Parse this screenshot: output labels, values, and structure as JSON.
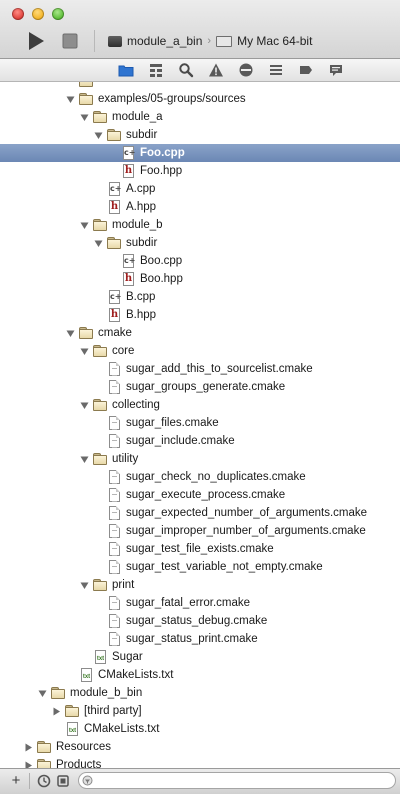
{
  "toolbar": {
    "scheme_target": "module_a_bin",
    "scheme_chevron": "›",
    "destination": "My Mac 64-bit",
    "icons": [
      "run-icon",
      "stop-icon",
      "scheme-icon",
      "mac-device-icon"
    ]
  },
  "navigator_tabs": [
    {
      "name": "project-navigator",
      "icon": "folder-icon",
      "active": true
    },
    {
      "name": "symbol-navigator",
      "icon": "hierarchy-icon",
      "active": false
    },
    {
      "name": "search-navigator",
      "icon": "search-icon",
      "active": false
    },
    {
      "name": "issue-navigator",
      "icon": "warning-icon",
      "active": false
    },
    {
      "name": "test-navigator",
      "icon": "diamond-icon",
      "active": false
    },
    {
      "name": "debug-navigator",
      "icon": "list-icon",
      "active": false
    },
    {
      "name": "breakpoint-navigator",
      "icon": "breakpoint-icon",
      "active": false
    },
    {
      "name": "log-navigator",
      "icon": "speech-bubble-icon",
      "active": false
    }
  ],
  "tree": [
    {
      "label": "",
      "type": "folder",
      "depth": 3,
      "disclosure": "none",
      "partial": true
    },
    {
      "label": "examples/05-groups/sources",
      "type": "folder",
      "depth": 3,
      "disclosure": "open"
    },
    {
      "label": "module_a",
      "type": "folder",
      "depth": 4,
      "disclosure": "open"
    },
    {
      "label": "subdir",
      "type": "folder",
      "depth": 5,
      "disclosure": "open"
    },
    {
      "label": "Foo.cpp",
      "type": "cpp",
      "depth": 6,
      "disclosure": "none",
      "selected": true
    },
    {
      "label": "Foo.hpp",
      "type": "hpp",
      "depth": 6,
      "disclosure": "none"
    },
    {
      "label": "A.cpp",
      "type": "cpp",
      "depth": 5,
      "disclosure": "none"
    },
    {
      "label": "A.hpp",
      "type": "hpp",
      "depth": 5,
      "disclosure": "none"
    },
    {
      "label": "module_b",
      "type": "folder",
      "depth": 4,
      "disclosure": "open"
    },
    {
      "label": "subdir",
      "type": "folder",
      "depth": 5,
      "disclosure": "open"
    },
    {
      "label": "Boo.cpp",
      "type": "cpp",
      "depth": 6,
      "disclosure": "none"
    },
    {
      "label": "Boo.hpp",
      "type": "hpp",
      "depth": 6,
      "disclosure": "none"
    },
    {
      "label": "B.cpp",
      "type": "cpp",
      "depth": 5,
      "disclosure": "none"
    },
    {
      "label": "B.hpp",
      "type": "hpp",
      "depth": 5,
      "disclosure": "none"
    },
    {
      "label": "cmake",
      "type": "folder",
      "depth": 3,
      "disclosure": "open"
    },
    {
      "label": "core",
      "type": "folder",
      "depth": 4,
      "disclosure": "open"
    },
    {
      "label": "sugar_add_this_to_sourcelist.cmake",
      "type": "doc",
      "depth": 5,
      "disclosure": "none"
    },
    {
      "label": "sugar_groups_generate.cmake",
      "type": "doc",
      "depth": 5,
      "disclosure": "none"
    },
    {
      "label": "collecting",
      "type": "folder",
      "depth": 4,
      "disclosure": "open"
    },
    {
      "label": "sugar_files.cmake",
      "type": "doc",
      "depth": 5,
      "disclosure": "none"
    },
    {
      "label": "sugar_include.cmake",
      "type": "doc",
      "depth": 5,
      "disclosure": "none"
    },
    {
      "label": "utility",
      "type": "folder",
      "depth": 4,
      "disclosure": "open"
    },
    {
      "label": "sugar_check_no_duplicates.cmake",
      "type": "doc",
      "depth": 5,
      "disclosure": "none"
    },
    {
      "label": "sugar_execute_process.cmake",
      "type": "doc",
      "depth": 5,
      "disclosure": "none"
    },
    {
      "label": "sugar_expected_number_of_arguments.cmake",
      "type": "doc",
      "depth": 5,
      "disclosure": "none"
    },
    {
      "label": "sugar_improper_number_of_arguments.cmake",
      "type": "doc",
      "depth": 5,
      "disclosure": "none"
    },
    {
      "label": "sugar_test_file_exists.cmake",
      "type": "doc",
      "depth": 5,
      "disclosure": "none"
    },
    {
      "label": "sugar_test_variable_not_empty.cmake",
      "type": "doc",
      "depth": 5,
      "disclosure": "none"
    },
    {
      "label": "print",
      "type": "folder",
      "depth": 4,
      "disclosure": "open"
    },
    {
      "label": "sugar_fatal_error.cmake",
      "type": "doc",
      "depth": 5,
      "disclosure": "none"
    },
    {
      "label": "sugar_status_debug.cmake",
      "type": "doc",
      "depth": 5,
      "disclosure": "none"
    },
    {
      "label": "sugar_status_print.cmake",
      "type": "doc",
      "depth": 5,
      "disclosure": "none"
    },
    {
      "label": "Sugar",
      "type": "txt",
      "depth": 4,
      "disclosure": "none"
    },
    {
      "label": "CMakeLists.txt",
      "type": "txt",
      "depth": 3,
      "disclosure": "none"
    },
    {
      "label": "module_b_bin",
      "type": "folder",
      "depth": 1,
      "disclosure": "open"
    },
    {
      "label": "[third party]",
      "type": "folder",
      "depth": 2,
      "disclosure": "closed"
    },
    {
      "label": "CMakeLists.txt",
      "type": "txt",
      "depth": 2,
      "disclosure": "none"
    },
    {
      "label": "Resources",
      "type": "folder",
      "depth": 0,
      "disclosure": "closed"
    },
    {
      "label": "Products",
      "type": "folder",
      "depth": 0,
      "disclosure": "closed"
    }
  ],
  "icon_text": {
    "cpp": "c+",
    "hpp": "h",
    "txt": "txt"
  },
  "bottom_bar": {
    "add_label": "+",
    "icons": [
      "add-icon",
      "recent-files-icon",
      "source-control-icon",
      "filter-icon"
    ],
    "filter_placeholder": ""
  },
  "colors": {
    "selection": "#6b87b4",
    "selection_text": "#ffffff",
    "folder": "#e8d9a9",
    "header_glyph": "#a02020"
  }
}
